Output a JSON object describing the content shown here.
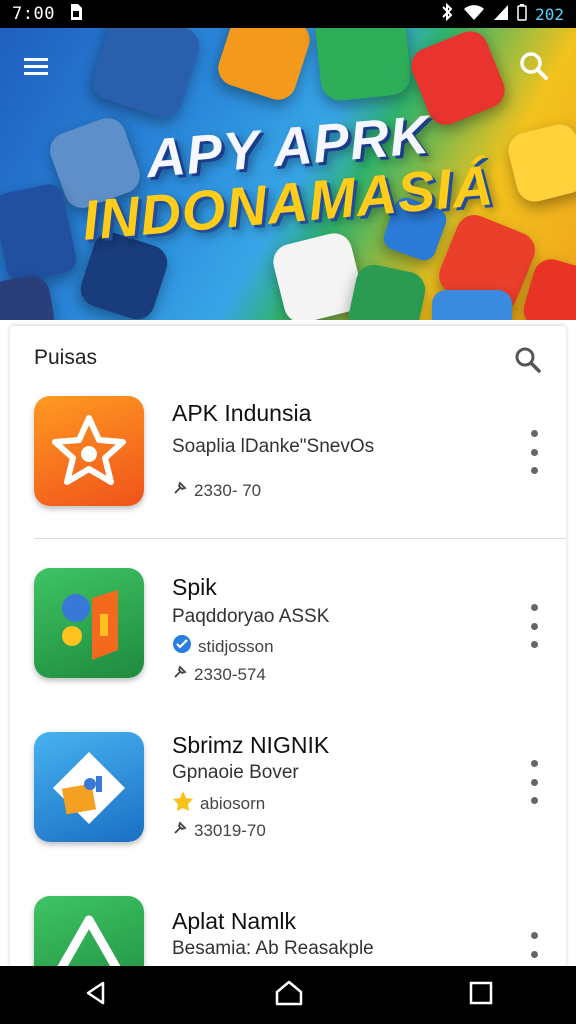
{
  "status_bar": {
    "time": "7:00",
    "battery": "202",
    "icons": [
      "sim-icon",
      "bluetooth-icon",
      "wifi-icon",
      "signal-icon",
      "battery-icon"
    ]
  },
  "banner": {
    "title_line1": "APY APRK",
    "title_line2": "INDONAMASIÁ",
    "menu_icon": "hamburger-menu-icon",
    "search_icon": "search-icon"
  },
  "list": {
    "header": "Puisas",
    "search_icon": "search-icon",
    "items": [
      {
        "name": "APK Indunsia",
        "subtitle": "Soaplia lDanke\"SnevOs",
        "badge": "",
        "meta": "2330- 70",
        "icon": "orange-star-app-icon",
        "colors": [
          "#ff8a1a",
          "#f04e18"
        ]
      },
      {
        "name": "Spik",
        "subtitle": "Paqddoryao ASSK",
        "badge": "stidjosson",
        "meta": "2330-574",
        "icon": "green-orange-app-icon",
        "colors": [
          "#35b45a",
          "#1f8a3e"
        ]
      },
      {
        "name": "Sbrimz NIGNIK",
        "subtitle": "Gpnaoie Bover",
        "badge": "abiosorn",
        "meta": "33019-70",
        "icon": "blue-diamond-app-icon",
        "colors": [
          "#3aa3ea",
          "#1a6fc4"
        ]
      },
      {
        "name": "Aplat Namlk",
        "subtitle": "Besamia: Ab Reasakple",
        "badge": "",
        "meta": "",
        "icon": "green-triangle-app-icon",
        "colors": [
          "#34b35a",
          "#1f8d3f"
        ]
      }
    ]
  },
  "nav": {
    "back_icon": "back-icon",
    "home_icon": "home-icon",
    "recents_icon": "recents-icon"
  }
}
